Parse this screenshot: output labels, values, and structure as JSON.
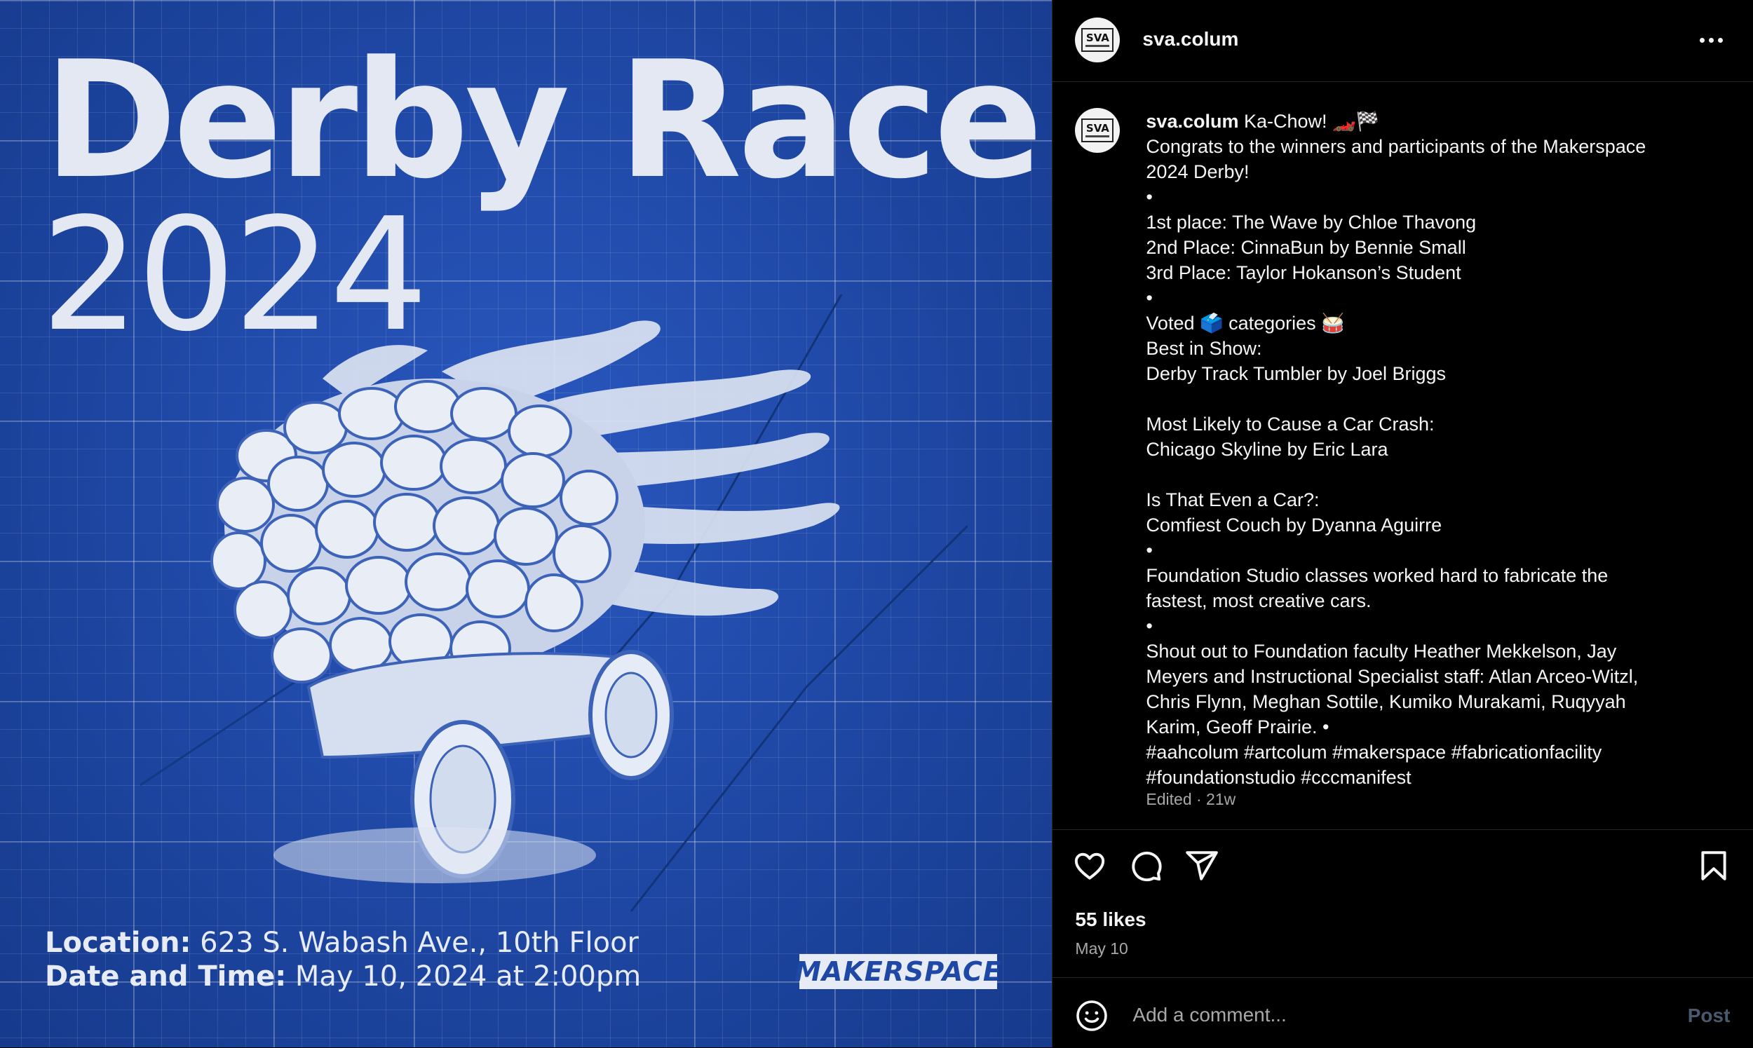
{
  "poster": {
    "title": "Derby Race",
    "year": "2024",
    "location_label": "Location:",
    "location_value": " 623 S. Wabash Ave., 10th Floor",
    "datetime_label": "Date and Time:",
    "datetime_value": " May 10, 2024 at 2:00pm",
    "badge": "MAKERSPACE"
  },
  "header": {
    "avatar_text": "SVA",
    "username": "sva.colum"
  },
  "caption": {
    "username": "sva.colum",
    "first_line": " Ka-Chow! 🏎️🏁",
    "lines": [
      "Congrats to the winners and participants of the Makerspace",
      "2024 Derby!",
      "•",
      "1st place: The Wave by Chloe Thavong",
      "2nd Place: CinnaBun by Bennie Small",
      "3rd Place: Taylor Hokanson’s Student",
      "•",
      "Voted 🗳️ categories 🥁",
      "Best in Show:",
      "Derby Track Tumbler by Joel Briggs",
      "",
      "Most Likely to Cause a Car Crash:",
      "Chicago Skyline by Eric Lara",
      "",
      "Is That Even a Car?:",
      "Comfiest Couch by Dyanna Aguirre",
      "•",
      "Foundation Studio classes worked hard to fabricate the",
      "fastest, most creative cars.",
      "•",
      "Shout out to Foundation faculty Heather Mekkelson, Jay",
      "Meyers and Instructional Specialist staff: Atlan Arceo-Witzl,",
      "Chris Flynn, Meghan Sottile, Kumiko Murakami, Ruqyyah",
      "Karim, Geoff Prairie. •",
      "#aahcolum #artcolum #makerspace #fabricationfacility",
      "#foundationstudio #cccmanifest"
    ],
    "meta": "Edited · 21w"
  },
  "actions": {
    "icons": [
      "heart-icon",
      "comment-icon",
      "share-icon",
      "bookmark-icon"
    ]
  },
  "likes": "55 likes",
  "date": "May 10",
  "comment": {
    "placeholder": "Add a comment...",
    "post_label": "Post"
  }
}
